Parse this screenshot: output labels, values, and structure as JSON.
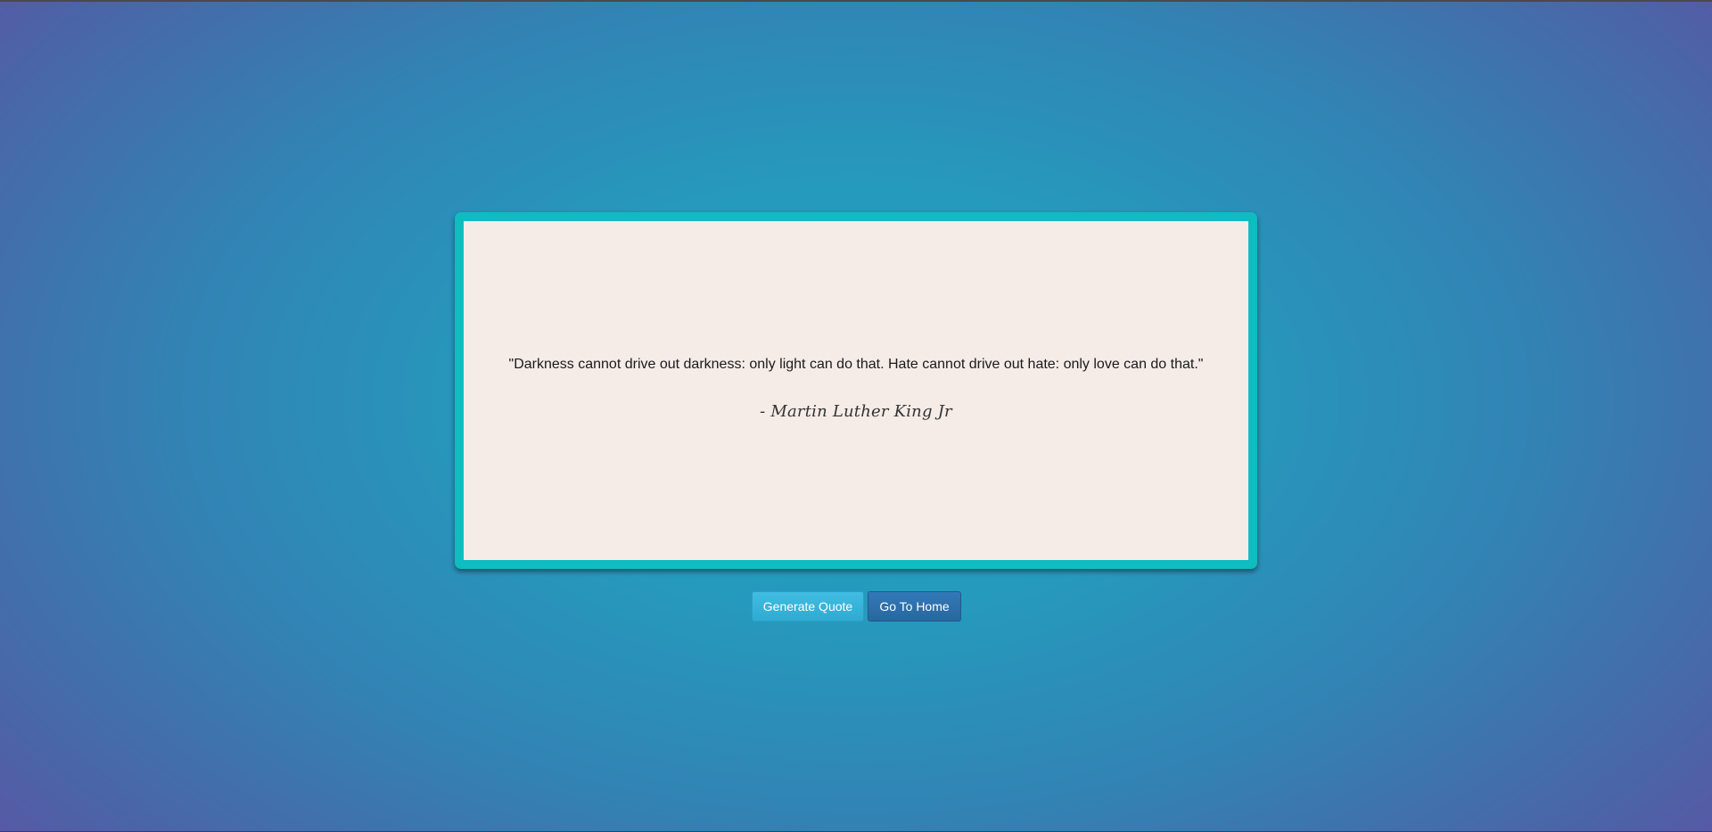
{
  "quote": {
    "text": "\"Darkness cannot drive out darkness: only light can do that. Hate cannot drive out hate: only love can do that.\"",
    "author": "- Martin Luther King Jr"
  },
  "actions": {
    "generate_label": "Generate Quote",
    "home_label": "Go To Home"
  },
  "colors": {
    "frame": "#0fbcc0",
    "card": "#f5ece8",
    "generate_button": "#39b3d7",
    "home_button": "#2e6da4"
  }
}
